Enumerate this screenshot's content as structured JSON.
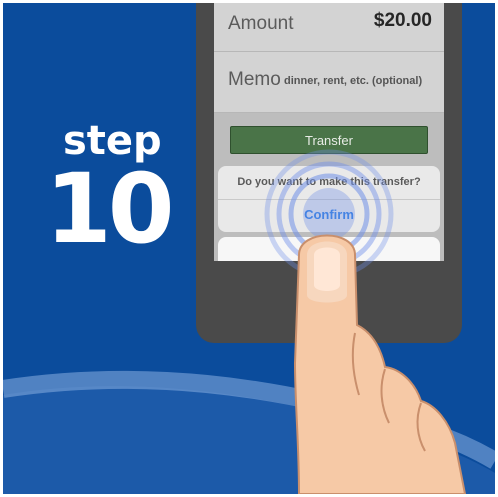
{
  "step": {
    "word": "step",
    "number": "10"
  },
  "form": {
    "amount_label": "Amount",
    "amount_value": "$20.00",
    "memo_label": "Memo",
    "memo_placeholder": "dinner, rent, etc. (optional)"
  },
  "transfer_button": {
    "label": "Transfer"
  },
  "dialog": {
    "message": "Do you want to make this transfer?",
    "confirm_label": "Confirm"
  },
  "icons": {
    "tap": "tap-ripple-icon",
    "hand": "pointing-hand-icon"
  },
  "colors": {
    "background": "#0b4c9c",
    "transfer_button": "#4a7448",
    "confirm_text": "#2f7de0",
    "ripple": "#6f8fe8",
    "skin": "#f6c9a6"
  }
}
